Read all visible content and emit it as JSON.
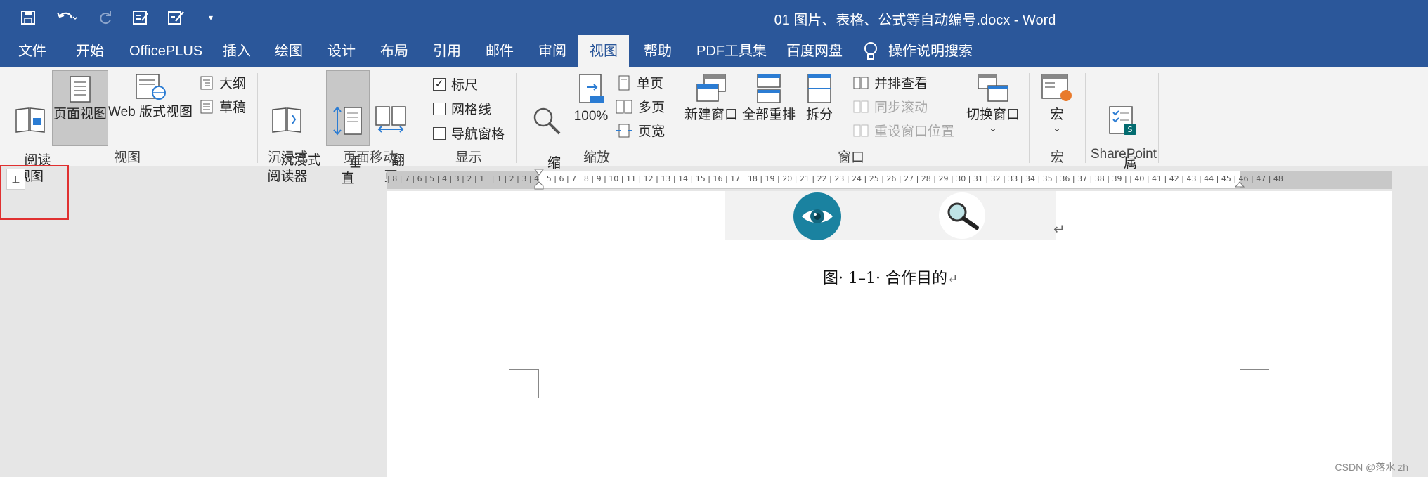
{
  "window": {
    "title": "01 图片、表格、公式等自动编号.docx  -  Word"
  },
  "tabs": [
    {
      "label": "文件"
    },
    {
      "label": "开始"
    },
    {
      "label": "OfficePLUS"
    },
    {
      "label": "插入"
    },
    {
      "label": "绘图"
    },
    {
      "label": "设计"
    },
    {
      "label": "布局"
    },
    {
      "label": "引用"
    },
    {
      "label": "邮件"
    },
    {
      "label": "审阅"
    },
    {
      "label": "视图"
    },
    {
      "label": "帮助"
    },
    {
      "label": "PDF工具集"
    },
    {
      "label": "百度网盘"
    },
    {
      "label": "操作说明搜索"
    }
  ],
  "ribbon": {
    "views": {
      "read": "阅读\n视图",
      "page": "页面视图",
      "web": "Web 版式视图",
      "outline": "大纲",
      "draft": "草稿",
      "label": "视图"
    },
    "immersive": {
      "reader": "沉浸式\n阅读器",
      "label": "沉浸式"
    },
    "pagemove": {
      "vertical": "垂\n直",
      "flip": "翻\n页",
      "label": "页面移动"
    },
    "show": {
      "ruler": "标尺",
      "gridlines": "网格线",
      "nav": "导航窗格",
      "label": "显示",
      "ruler_checked": "✓"
    },
    "zoom": {
      "zoom": "缩\n放",
      "percent": "100%",
      "single": "单页",
      "multi": "多页",
      "width": "页宽",
      "label": "缩放"
    },
    "window": {
      "new": "新建窗口",
      "arrange": "全部重排",
      "split": "拆分",
      "side": "并排查看",
      "sync": "同步滚动",
      "reset": "重设窗口位置",
      "switch": "切换窗口",
      "label": "窗口"
    },
    "macro": {
      "macro": "宏",
      "label": "宏"
    },
    "sharepoint": {
      "props": "属\n性",
      "label": "SharePoint"
    }
  },
  "ruler": {
    "text": "| 8 | 7 | 6 | 5 | 4 | 3 | 2 | 1 |   | 1 | 2 | 3 | 4 | 5 | 6 | 7 | 8 | 9 | 10 | 11 | 12 | 13 | 14 | 15 | 16 | 17 | 18 | 19 | 20 | 21 | 22 | 23 | 24 | 25 | 26 | 27 | 28 | 29 | 30 | 31 | 32 | 33 | 34 | 35 | 36 | 37 | 38 | 39 |   | 40 | 41 | 42 | 43 | 44 | 45 | 46 | 47 | 48"
  },
  "document": {
    "caption": "图· 1–1· 合作目的",
    "return_mark": "↵"
  },
  "watermark": "CSDN @落水 zh"
}
